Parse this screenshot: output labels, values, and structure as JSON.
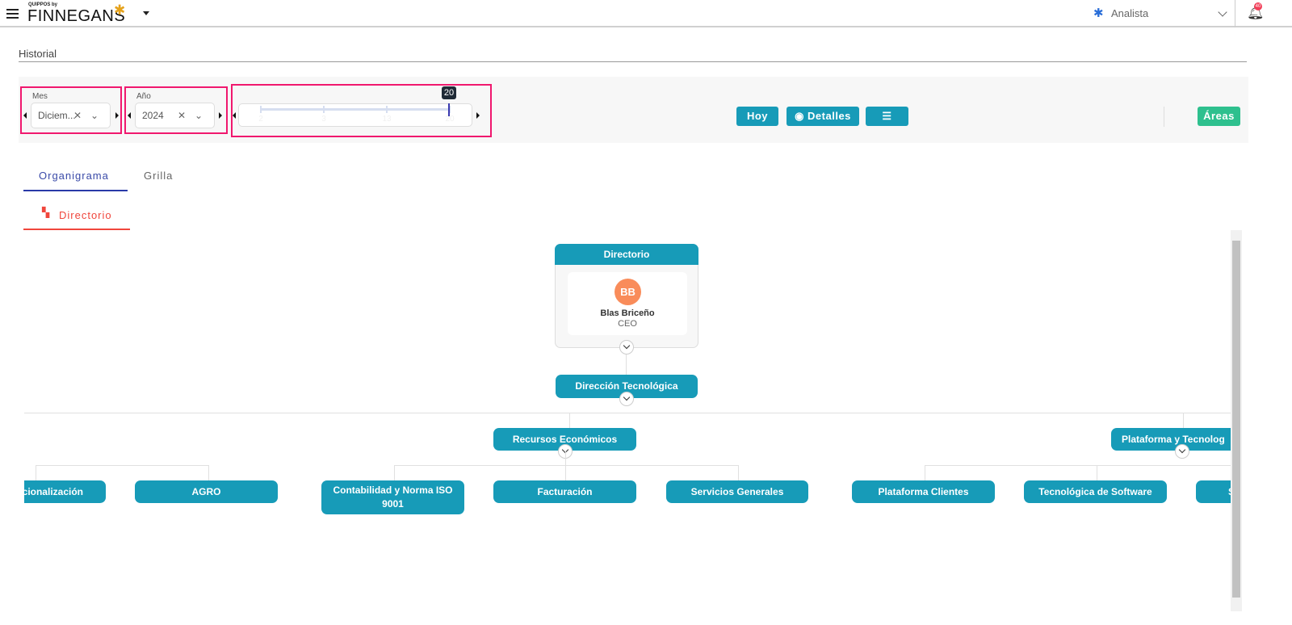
{
  "header": {
    "logo_small": "QUIPPOS by",
    "logo_big": "FINNEGANS",
    "role": "Analista",
    "notification_count": "40"
  },
  "page": {
    "title": "Historial"
  },
  "filters": {
    "month": {
      "label": "Mes",
      "value": "Diciem..."
    },
    "year": {
      "label": "Año",
      "value": "2024"
    },
    "day_slider": {
      "ticks": [
        "2",
        "3",
        "13",
        "20"
      ],
      "selected": "20"
    }
  },
  "toolbar": {
    "today": "Hoy",
    "details": "Detalles",
    "areas": "Áreas"
  },
  "tabs": [
    {
      "label": "Organigrama",
      "active": true
    },
    {
      "label": "Grilla",
      "active": false
    }
  ],
  "subtab": {
    "label": "Directorio"
  },
  "org": {
    "root": {
      "title": "Directorio",
      "person": {
        "initials": "BB",
        "name": "Blas Briceño",
        "role": "CEO"
      }
    },
    "level1": "Dirección Tecnológica",
    "level2": [
      "Recursos Económicos",
      "Plataforma y Tecnolog"
    ],
    "level3": [
      "cionalización",
      "AGRO",
      "Contabilidad y Norma ISO 9001",
      "Facturación",
      "Servicios Generales",
      "Plataforma Clientes",
      "Tecnológica de Software",
      "S"
    ]
  },
  "colors": {
    "primary": "#179bb8",
    "green": "#2ec08e",
    "accent_red": "#f0463c",
    "highlight": "#f0186e",
    "avatar": "#f98c5a"
  }
}
